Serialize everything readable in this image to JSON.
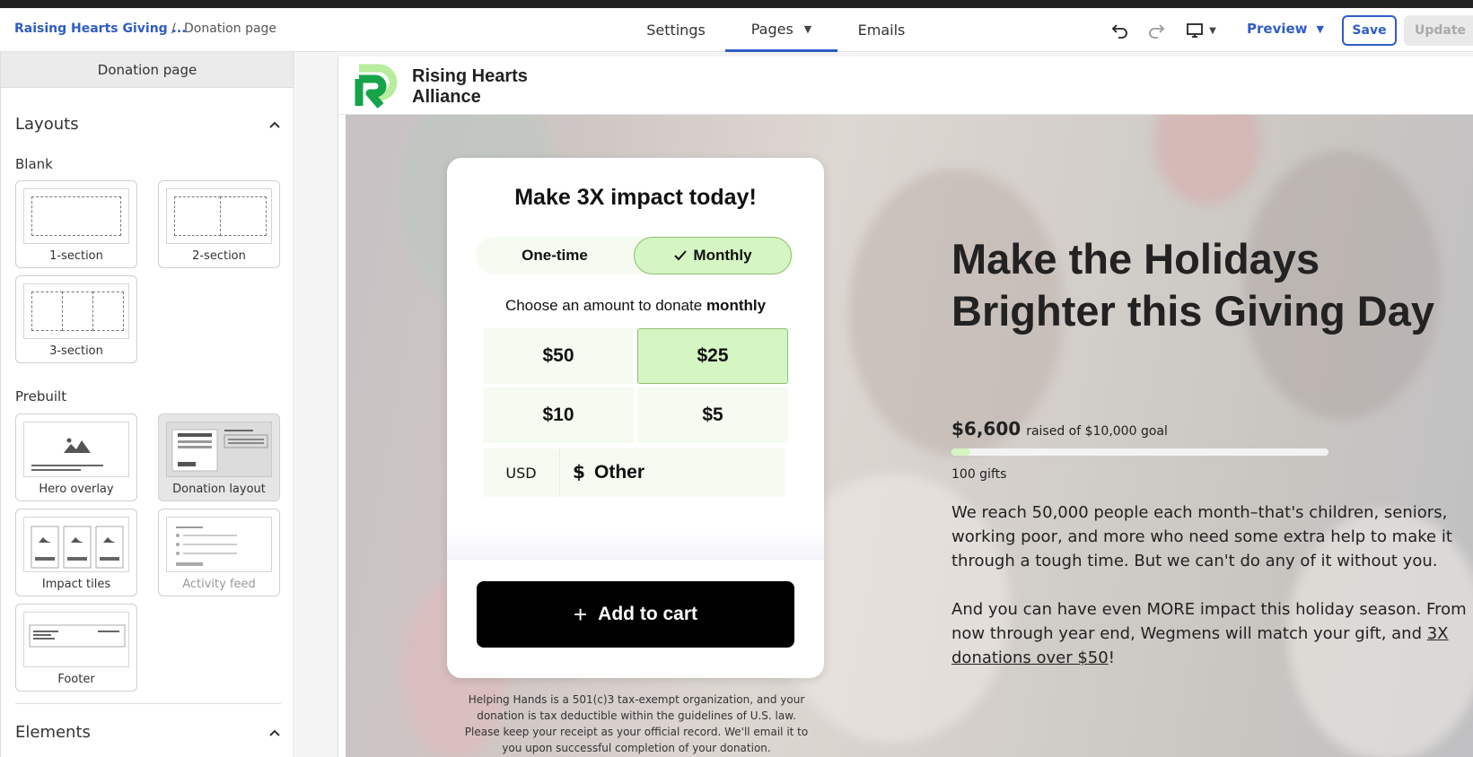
{
  "header": {
    "org_name": "Raising Hearts Giving ...",
    "separator": "/",
    "page_name": "Donation page",
    "tabs": [
      {
        "label": "Settings"
      },
      {
        "label": "Pages"
      },
      {
        "label": "Emails"
      }
    ],
    "undo_icon": "undo-icon",
    "redo_icon": "redo-icon",
    "device_icon": "desktop-icon",
    "preview_label": "Preview",
    "save_label": "Save",
    "update_label": "Update"
  },
  "sidebar": {
    "title": "Donation page",
    "layouts_heading": "Layouts",
    "blank_heading": "Blank",
    "blank_tiles": [
      {
        "label": "1-section"
      },
      {
        "label": "2-section"
      },
      {
        "label": "3-section"
      }
    ],
    "prebuilt_heading": "Prebuilt",
    "prebuilt_tiles": [
      {
        "label": "Hero overlay"
      },
      {
        "label": "Donation layout"
      },
      {
        "label": "Impact tiles"
      },
      {
        "label": "Activity feed"
      },
      {
        "label": "Footer"
      }
    ],
    "elements_heading": "Elements"
  },
  "page": {
    "logo_line1": "Rising Hearts",
    "logo_line2": "Alliance",
    "card": {
      "title": "Make 3X impact today!",
      "one_time_label": "One-time",
      "monthly_label": "Monthly",
      "choose_prefix": "Choose an amount to donate ",
      "choose_bold": "monthly",
      "amounts": [
        "$50",
        "$25",
        "$10",
        "$5"
      ],
      "selected_amount": "$25",
      "currency": "USD",
      "currency_symbol": "$",
      "other_placeholder": "Other",
      "cart_label": "Add to cart"
    },
    "disclaimer": "Helping Hands is a 501(c)3 tax-exempt organization, and your donation is tax deductible within the guidelines of U.S. law. Please keep your receipt as your official record. We'll email it to you upon successful completion of your donation.",
    "hero_title": "Make the Holidays Brighter this Giving Day",
    "raised_amount": "$6,600",
    "raised_goal": "raised of $10,000 goal",
    "progress_fraction": 0.05,
    "gifts": "100 gifts",
    "body1": "We reach 50,000 people each month–that's children, seniors, working poor, and more who need some extra help to make it through a tough time. But we can't do any of it without you.",
    "body2_prefix": "And you can have even MORE impact this holiday season. From now through year end, Wegmens will match your gift, and ",
    "body2_link": "3X donations over $50",
    "body2_suffix": "!"
  },
  "colors": {
    "accent_blue": "#2f5cc5",
    "brand_green": "#16a34a",
    "selected_green": "#d5f5c2",
    "cart_black": "#000000"
  }
}
